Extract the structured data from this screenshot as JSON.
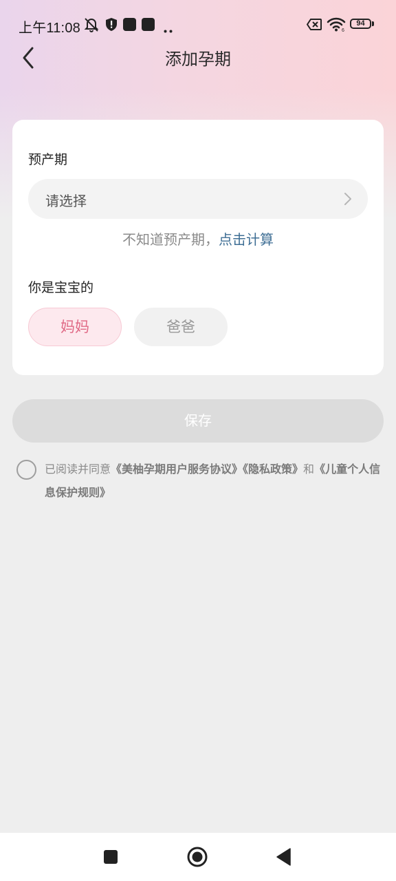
{
  "status_bar": {
    "time": "上午11:08",
    "battery": "94",
    "icons": [
      "mute-bell-icon",
      "shield-alert-icon",
      "app-square-icon",
      "app-square-icon",
      "more-dots-icon",
      "sim-off-icon",
      "wifi-icon",
      "battery-icon"
    ]
  },
  "header": {
    "title": "添加孕期",
    "back_icon": "chevron-left-icon"
  },
  "form": {
    "due_date_label": "预产期",
    "due_date_placeholder": "请选择",
    "hint_prefix": "不知道预产期，",
    "hint_link": "点击计算",
    "role_label": "你是宝宝的",
    "roles": [
      {
        "label": "妈妈",
        "selected": true
      },
      {
        "label": "爸爸",
        "selected": false
      }
    ]
  },
  "save_button": "保存",
  "agreement": {
    "prefix": "已阅读并同意",
    "doc1": "《美柚孕期用户服务协议》",
    "doc2": "《隐私政策》",
    "conj": "和",
    "doc3": "《儿童个人信息保护规则》"
  },
  "nav": {
    "icons": [
      "recents-square-icon",
      "home-circle-icon",
      "back-triangle-icon"
    ]
  },
  "colors": {
    "accent_pink": "#e06a86",
    "link_blue": "#3e6e94",
    "background": "#eeeeee"
  }
}
